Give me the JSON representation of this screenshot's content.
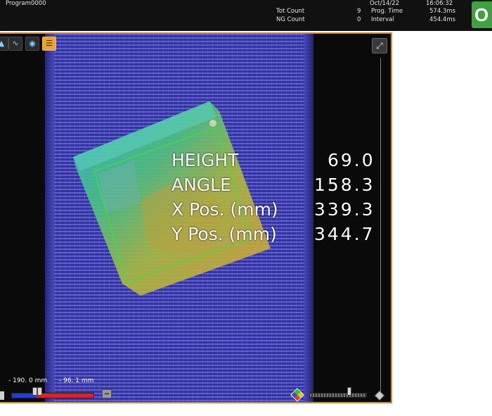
{
  "header": {
    "program": "Program0000",
    "date": "Oct/14/22",
    "time": "16:06:32",
    "tot_count_label": "Tot Count",
    "tot_count_value": "9",
    "ng_count_label": "NG Count",
    "ng_count_value": "0",
    "prog_time_label": "Prog. Time",
    "prog_time_value": "574.3ms",
    "interval_label": "Interval",
    "interval_value": "454.4ms",
    "judgement": "O"
  },
  "overlay": {
    "rows": [
      {
        "label": "HEIGHT",
        "value": "69.0"
      },
      {
        "label": "ANGLE",
        "value": "158.3"
      },
      {
        "label": "X  Pos. (mm)",
        "value": "339.3"
      },
      {
        "label": "Y  Pos. (mm)",
        "value": "344.7"
      }
    ]
  },
  "toolbar": {
    "icons": [
      "height-map-icon",
      "profile-icon",
      "circle-target-icon",
      "color-layers-icon"
    ]
  },
  "range": {
    "low": "- 190. 0  mm",
    "high": "- 96. 1  mm",
    "low_fraction": 0.28,
    "high_fraction": 0.34
  },
  "brightness": {
    "level": 0.7
  },
  "colors": {
    "accent_border": "#d88a1e",
    "ok_green": "#3fa23f",
    "belt_blue": "#3a3ab0"
  }
}
